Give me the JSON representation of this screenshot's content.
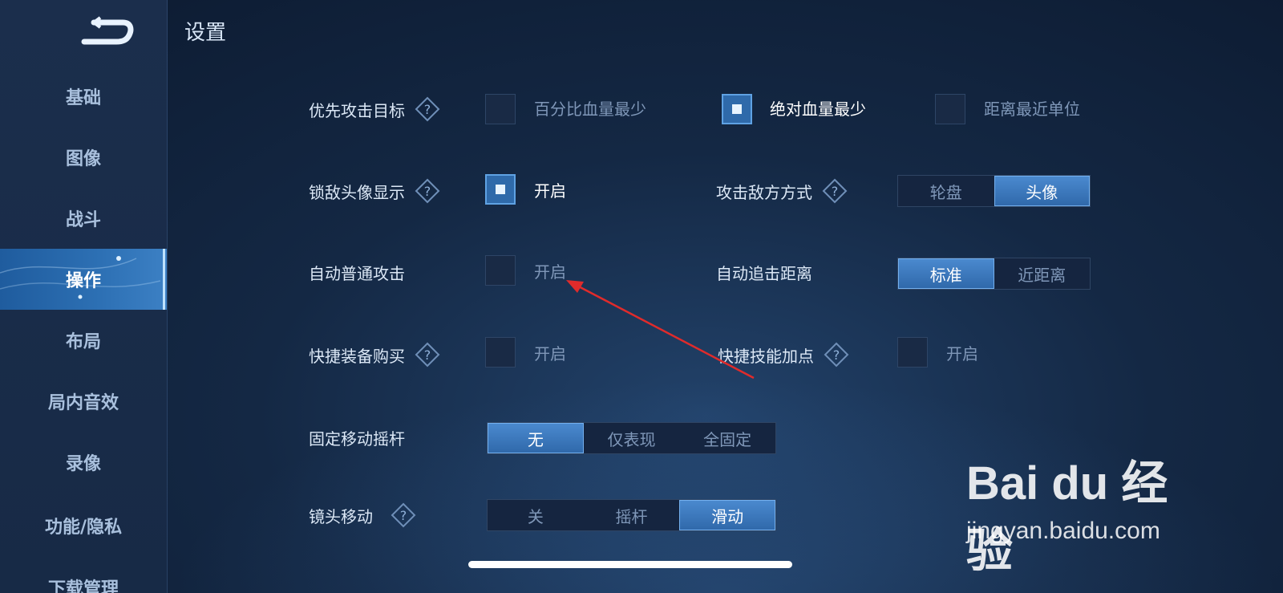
{
  "header": {
    "title": "设置"
  },
  "sidebar": {
    "items": [
      {
        "label": "基础"
      },
      {
        "label": "图像"
      },
      {
        "label": "战斗"
      },
      {
        "label": "操作",
        "active": true
      },
      {
        "label": "布局"
      },
      {
        "label": "局内音效"
      },
      {
        "label": "录像"
      },
      {
        "label": "功能/隐私"
      },
      {
        "label": "下载管理"
      }
    ]
  },
  "settings": {
    "priority_target": {
      "label": "优先攻击目标",
      "options": [
        {
          "label": "百分比血量最少",
          "checked": false
        },
        {
          "label": "绝对血量最少",
          "checked": true
        },
        {
          "label": "距离最近单位",
          "checked": false
        }
      ]
    },
    "lock_avatar": {
      "label": "锁敌头像显示",
      "option": "开启",
      "checked": true
    },
    "attack_mode": {
      "label": "攻击敌方方式",
      "options": [
        "轮盘",
        "头像"
      ],
      "selected": "头像"
    },
    "auto_attack": {
      "label": "自动普通攻击",
      "option": "开启",
      "checked": false
    },
    "chase_distance": {
      "label": "自动追击距离",
      "options": [
        "标准",
        "近距离"
      ],
      "selected": "标准"
    },
    "quick_buy": {
      "label": "快捷装备购买",
      "option": "开启",
      "checked": false
    },
    "quick_skill": {
      "label": "快捷技能加点",
      "option": "开启",
      "checked": false
    },
    "fixed_joystick": {
      "label": "固定移动摇杆",
      "options": [
        "无",
        "仅表现",
        "全固定"
      ],
      "selected": "无"
    },
    "camera_move": {
      "label": "镜头移动",
      "options": [
        "关",
        "摇杆",
        "滑动"
      ],
      "selected": "滑动"
    }
  },
  "watermark": {
    "brand": "Bai du 经验",
    "url": "jingyan.baidu.com"
  },
  "colors": {
    "accent": "#3f7fc4",
    "background": "#132641",
    "annotation": "#e02b2b"
  },
  "icons": {
    "back": "back-arrow-icon",
    "help": "help-diamond-icon"
  }
}
